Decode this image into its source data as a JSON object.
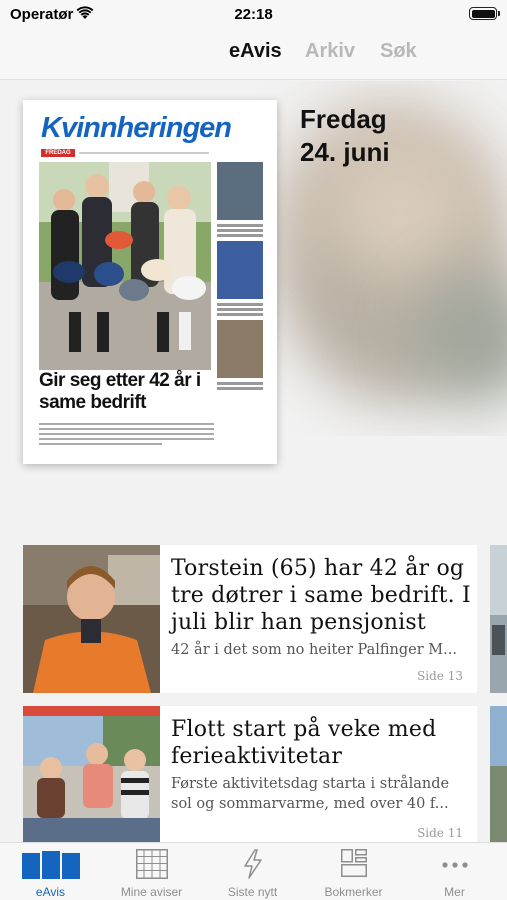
{
  "status_bar": {
    "carrier": "Operatør",
    "time": "22:18"
  },
  "top_nav": {
    "tabs": [
      "eAvis",
      "Arkiv",
      "Søk"
    ],
    "active": "eAvis"
  },
  "edition": {
    "day": "Fredag",
    "date": "24. juni",
    "newspaper_title": "Kvinnheringen",
    "front_label": "FREDAG",
    "headline": "Gir seg etter 42 år i same bedrift"
  },
  "articles": [
    {
      "title": "Torstein (65) har 42 år og tre døtrer i same bedrift. I juli blir han pensjonist",
      "lead": "42 år i det som no heiter Palfinger M...",
      "page": "Side 13"
    },
    {
      "title": "Flott start på veke med ferieaktivitetar",
      "lead": "Første aktivitetsdag starta i strålande sol og sommarvarme, med over 40 f...",
      "page": "Side 11"
    }
  ],
  "tab_bar": {
    "items": [
      {
        "label": "eAvis",
        "icon": "newspaper-pages-icon"
      },
      {
        "label": "Mine aviser",
        "icon": "grid-icon"
      },
      {
        "label": "Siste nytt",
        "icon": "lightning-icon"
      },
      {
        "label": "Bokmerker",
        "icon": "bookmark-layout-icon"
      },
      {
        "label": "Mer",
        "icon": "more-dots-icon"
      }
    ],
    "active_index": 0
  },
  "colors": {
    "accent": "#1565c0",
    "inactive_tab": "#b8b8b8",
    "tab_label": "#8e8e8e",
    "newspaper_red": "#d32f2f"
  }
}
